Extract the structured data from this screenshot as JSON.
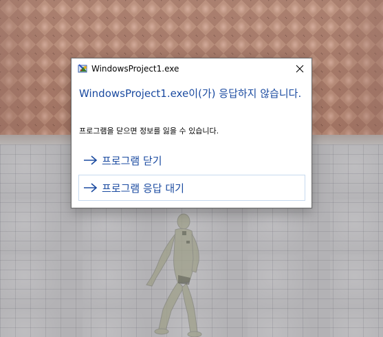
{
  "dialog": {
    "window_title": "WindowsProject1.exe",
    "app_icon": "application-icon",
    "close_icon": "close-icon",
    "heading": "WindowsProject1.exe이(가) 응답하지 않습니다.",
    "message": "프로그램을 닫으면 정보를 잃을 수 있습니다.",
    "options": [
      {
        "label": "프로그램 닫기",
        "icon": "arrow-right-icon"
      },
      {
        "label": "프로그램 응답 대기",
        "icon": "arrow-right-icon"
      }
    ],
    "accent_color": "#1a4aa0"
  }
}
